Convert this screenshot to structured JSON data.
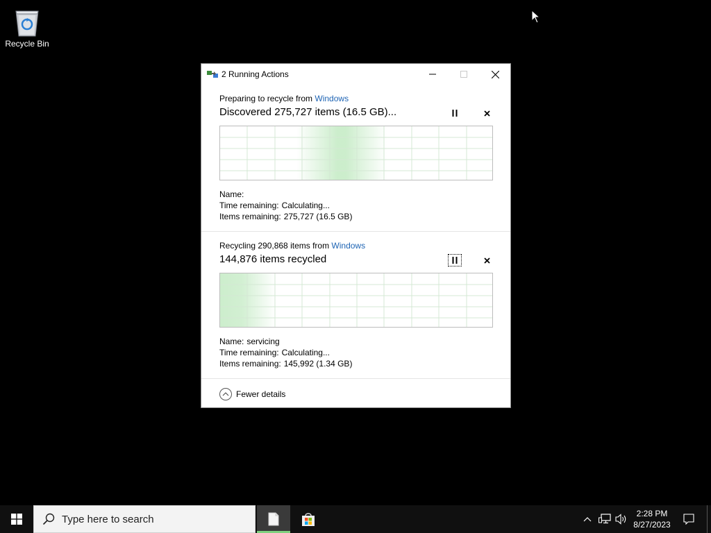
{
  "desktop": {
    "icons": [
      {
        "label": "Recycle Bin",
        "icon": "recycle-bin-icon"
      }
    ]
  },
  "dialog": {
    "title": "2 Running Actions",
    "operations": [
      {
        "prefix": "Preparing to recycle from ",
        "link": "Windows",
        "status": "Discovered 275,727 items (16.5 GB)...",
        "name_label": "Name:",
        "name_value": "",
        "time_label": "Time remaining:",
        "time_value": "Calculating...",
        "items_label": "Items remaining:",
        "items_value": "275,727 (16.5 GB)"
      },
      {
        "prefix": "Recycling 290,868 items from ",
        "link": "Windows",
        "status": "144,876 items recycled",
        "name_label": "Name:",
        "name_value": "servicing",
        "time_label": "Time remaining:",
        "time_value": "Calculating...",
        "items_label": "Items remaining:",
        "items_value": "145,992 (1.34 GB)"
      }
    ],
    "fewer_details": "Fewer details"
  },
  "taskbar": {
    "search_placeholder": "Type here to search",
    "time": "2:28 PM",
    "date": "8/27/2023"
  },
  "colors": {
    "link": "#1e64b4",
    "graph_glow": "#8fd88f",
    "taskbar": "#101010"
  }
}
